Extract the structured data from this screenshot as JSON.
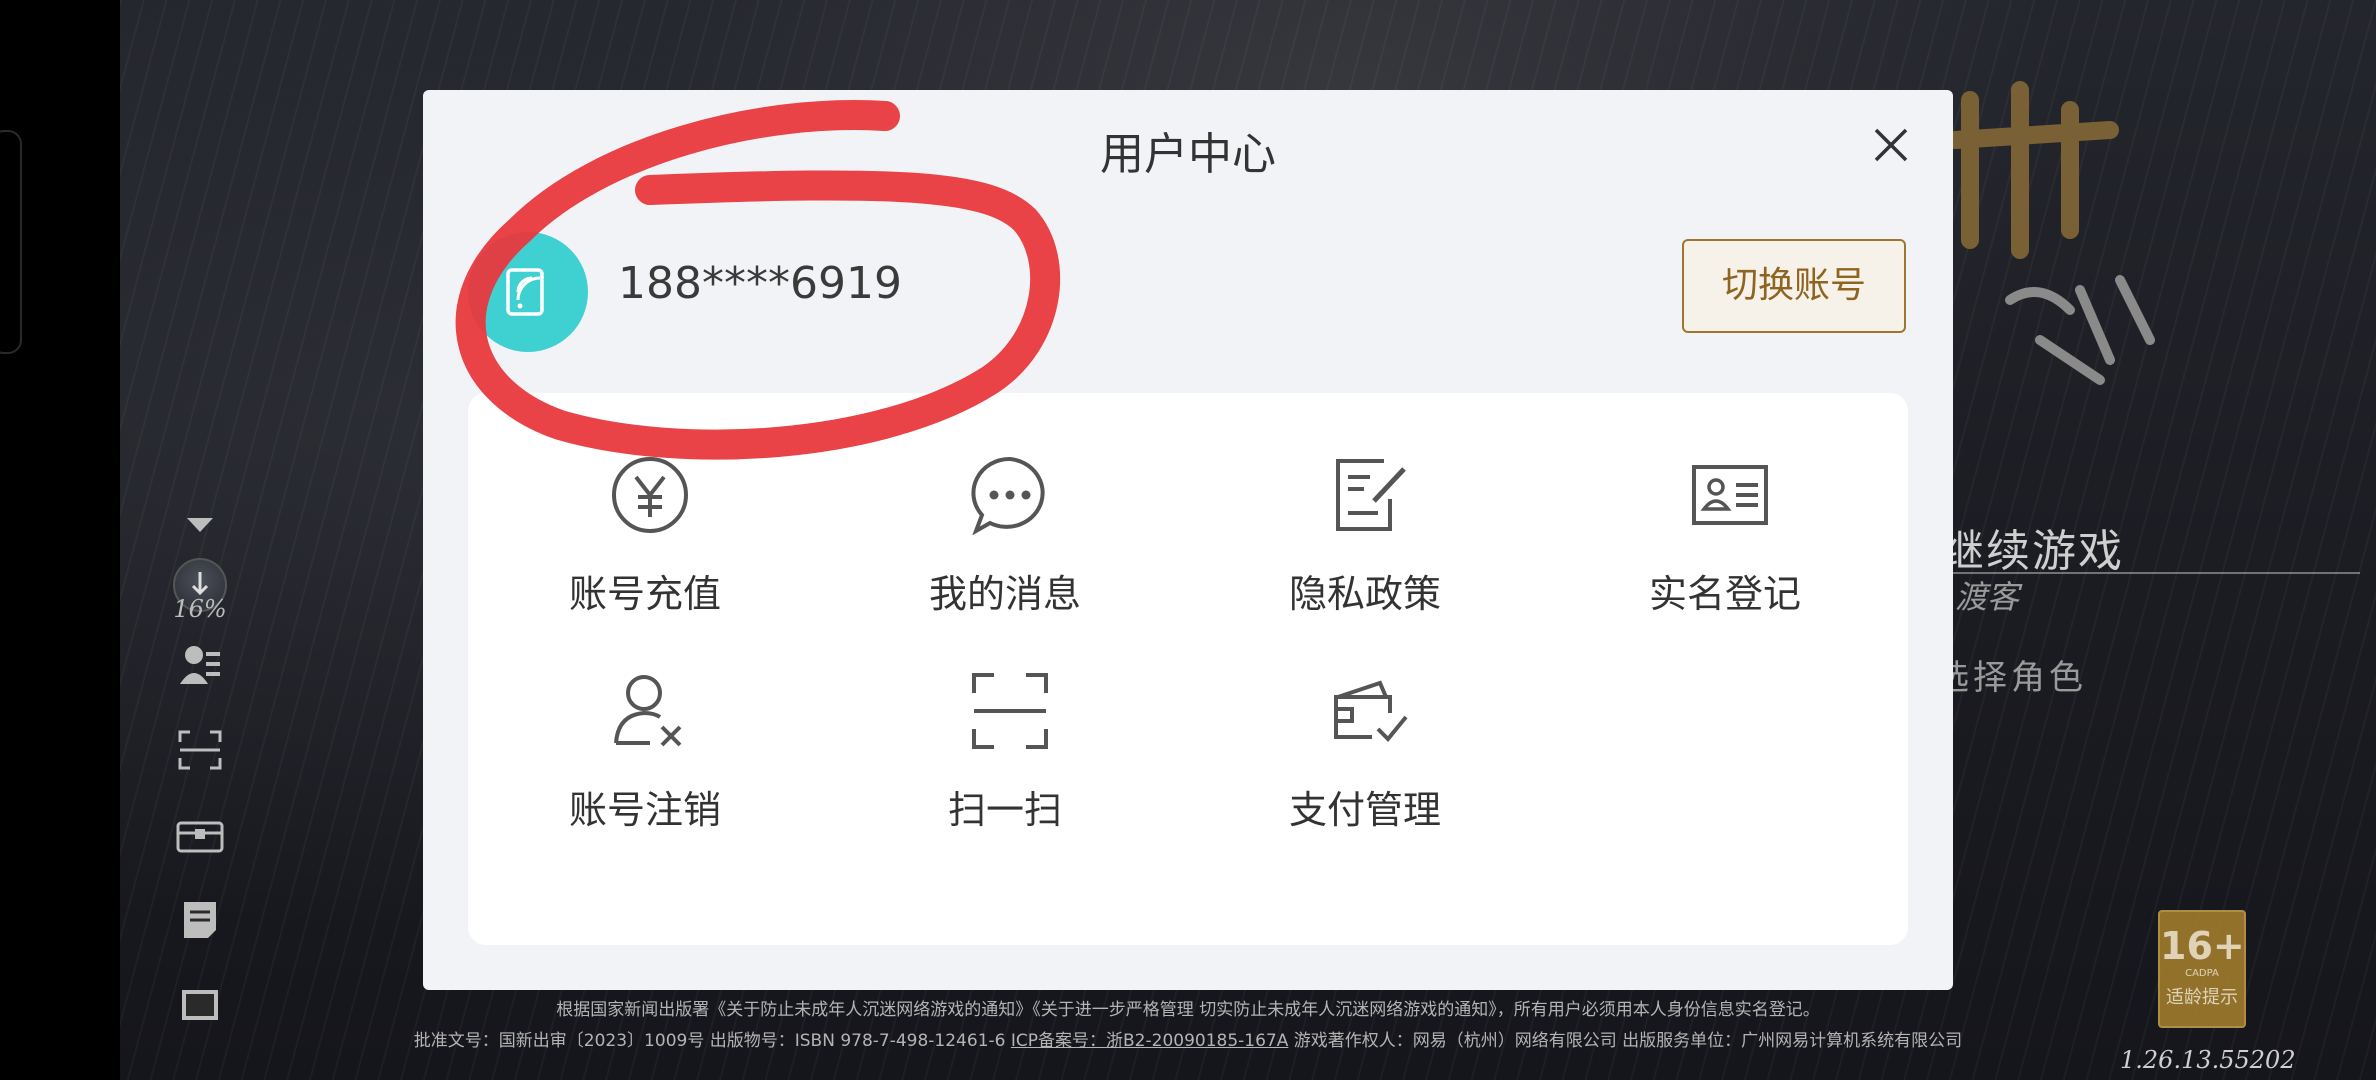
{
  "dialog": {
    "title": "用户中心",
    "account_number": "188****6919",
    "switch_account_label": "切换账号",
    "menu": [
      {
        "label": "账号充值",
        "icon": "yuan-circle-icon"
      },
      {
        "label": "我的消息",
        "icon": "chat-bubble-icon"
      },
      {
        "label": "隐私政策",
        "icon": "document-edit-icon"
      },
      {
        "label": "实名登记",
        "icon": "id-card-icon"
      },
      {
        "label": "账号注销",
        "icon": "user-remove-icon"
      },
      {
        "label": "扫一扫",
        "icon": "scan-icon"
      },
      {
        "label": "支付管理",
        "icon": "wallet-check-icon"
      }
    ]
  },
  "sidebar": {
    "download_percent": "16%"
  },
  "game": {
    "continue_label": "继续游戏",
    "role_name": "渡客",
    "choose_role_label": "选择角色",
    "notice_line1": "根据国家新闻出版署《关于防止未成年人沉迷网络游戏的通知》《关于进一步严格管理 切实防止未成年人沉迷网络游戏的通知》，所有用户必须用本人身份信息实名登记。",
    "notice_line2_a": "批准文号：国新出审〔2023〕1009号 出版物号：ISBN 978-7-498-12461-6 ",
    "notice_line2_icp": "ICP备案号：浙B2-20090185-167A",
    "notice_line2_b": " 游戏著作权人：网易（杭州）网络有限公司  出版服务单位：广州网易计算机系统有限公司",
    "age_rating": "16+",
    "age_rating_org": "CADPA",
    "age_tip": "适龄提示",
    "version": "1.26.13.55202"
  },
  "colors": {
    "accent_gold": "#a0762f",
    "avatar_teal": "#3fd0d2",
    "annotation_red": "#e8383d"
  }
}
